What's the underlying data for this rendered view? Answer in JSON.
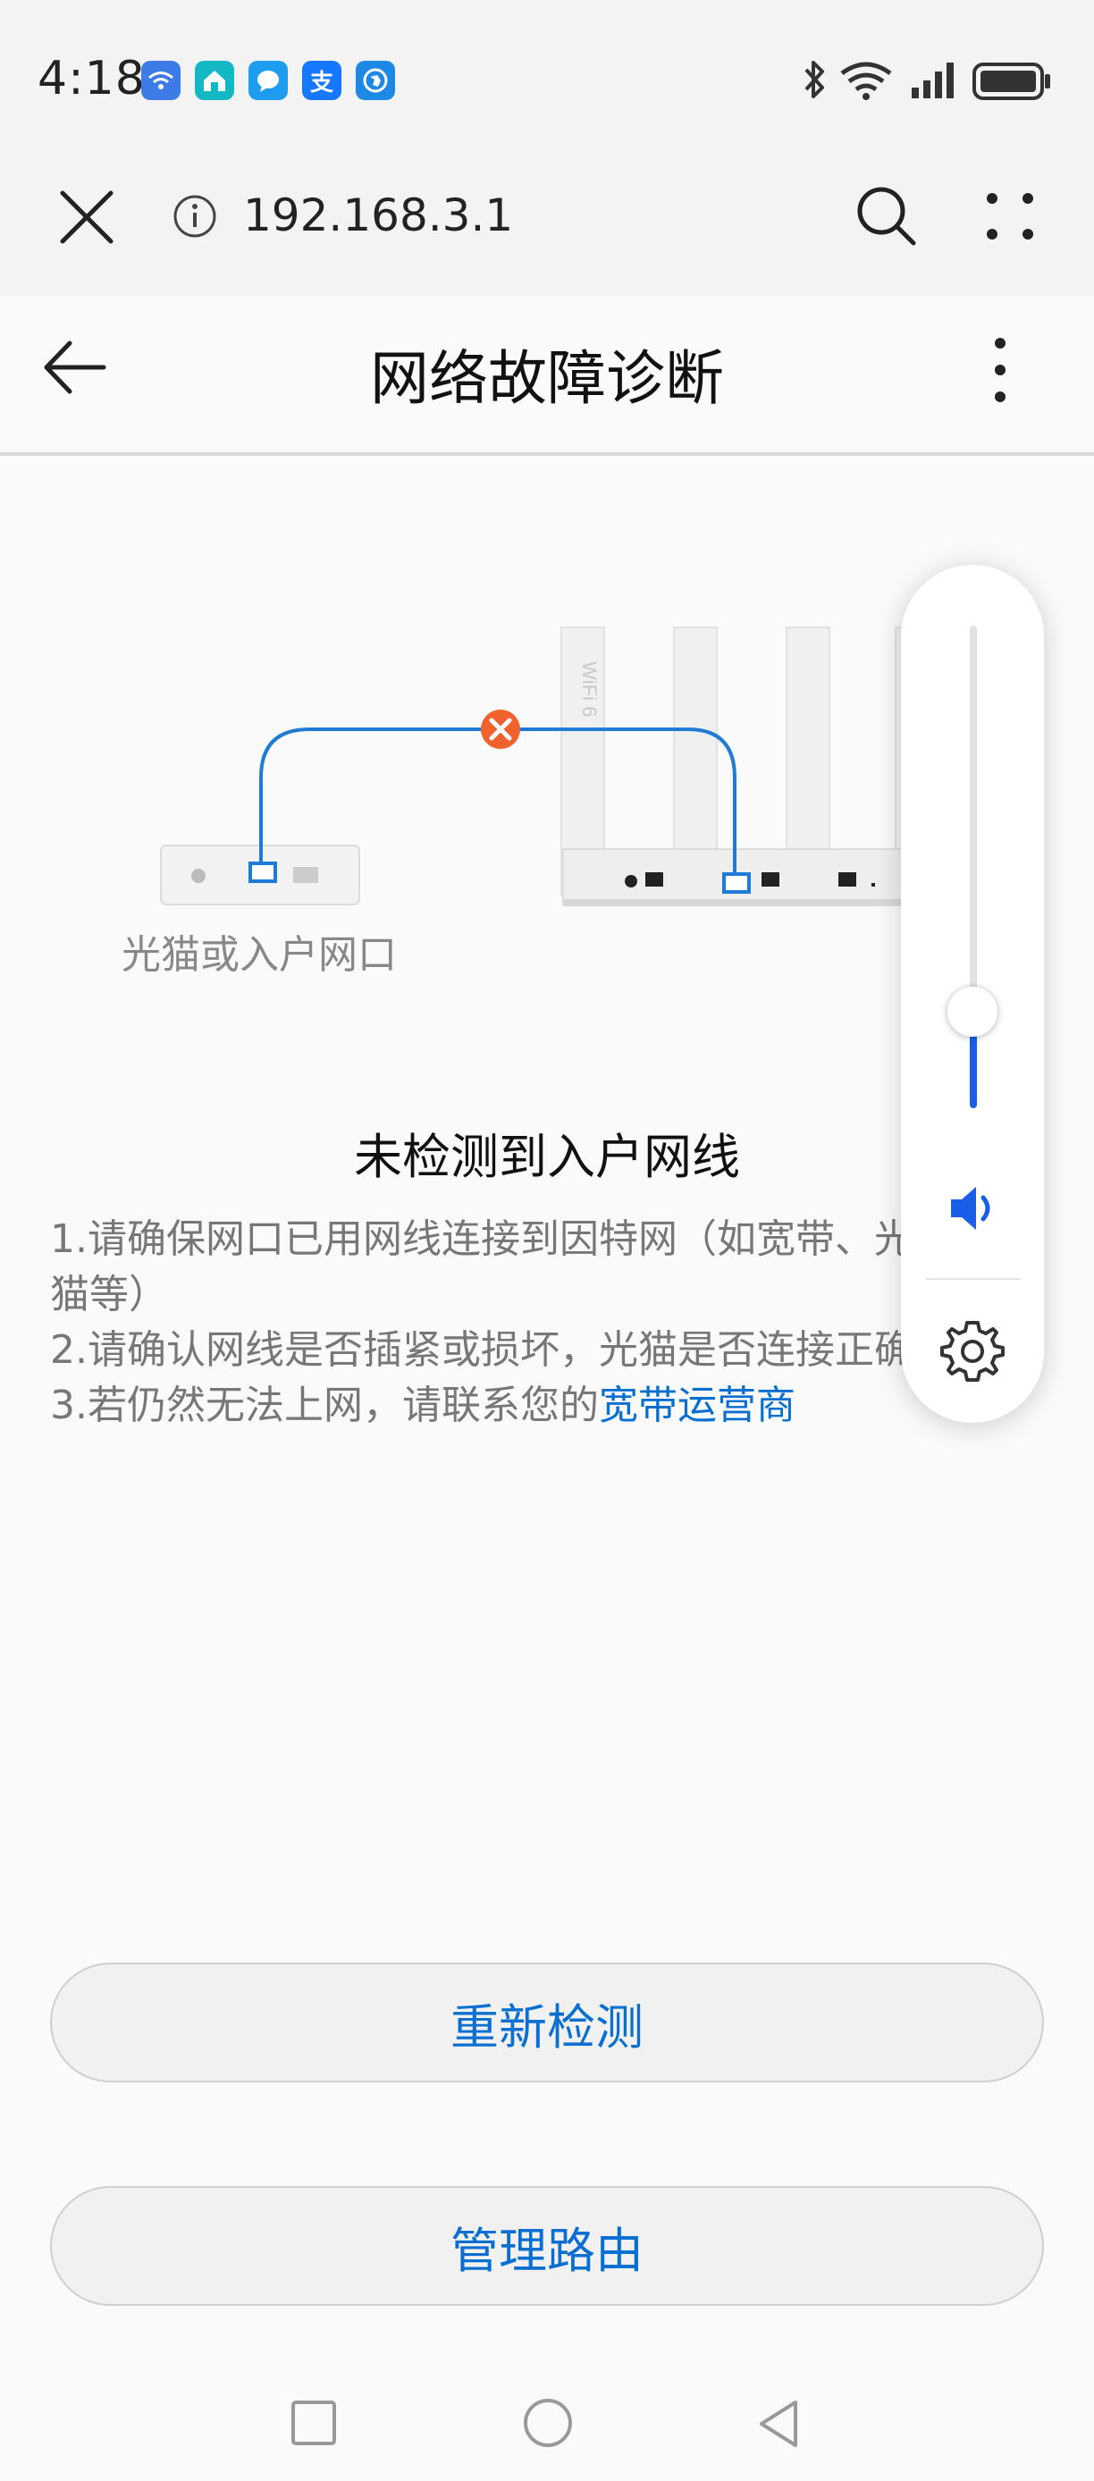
{
  "status_bar": {
    "time": "4:18",
    "app_icons": [
      {
        "name": "wifi-assist-icon",
        "color": "#3d7be8",
        "glyph": "◉"
      },
      {
        "name": "home-app-icon",
        "color": "#14b8c4",
        "glyph": "⌂"
      },
      {
        "name": "message-app-icon",
        "color": "#1e9cf0",
        "glyph": "●"
      },
      {
        "name": "alipay-icon",
        "color": "#1677ff",
        "glyph": "支"
      },
      {
        "name": "browser-app-icon",
        "color": "#1e88e5",
        "glyph": "◎"
      }
    ]
  },
  "browser": {
    "url": "192.168.3.1"
  },
  "page": {
    "title": "网络故障诊断"
  },
  "diagram": {
    "modem_label": "光猫或入户网口",
    "router_brand": "WiFi 6"
  },
  "message": {
    "title": "未检测到入户网线",
    "tip1_line1": "1.请确保网口已用网线连接到因特网（如宽带、光",
    "tip1_line2": "猫等）",
    "tip2": "2.请确认网线是否插紧或损坏，光猫是否连接正确",
    "tip3_prefix": "3.若仍然无法上网，请联系您的",
    "tip3_link": "宽带运营商"
  },
  "volume": {
    "level_percent": 20
  },
  "buttons": {
    "redetect": "重新检测",
    "manage_router": "管理路由"
  },
  "colors": {
    "accent": "#0a6fd1",
    "volume": "#1a5ee8",
    "error": "#f0632c"
  }
}
